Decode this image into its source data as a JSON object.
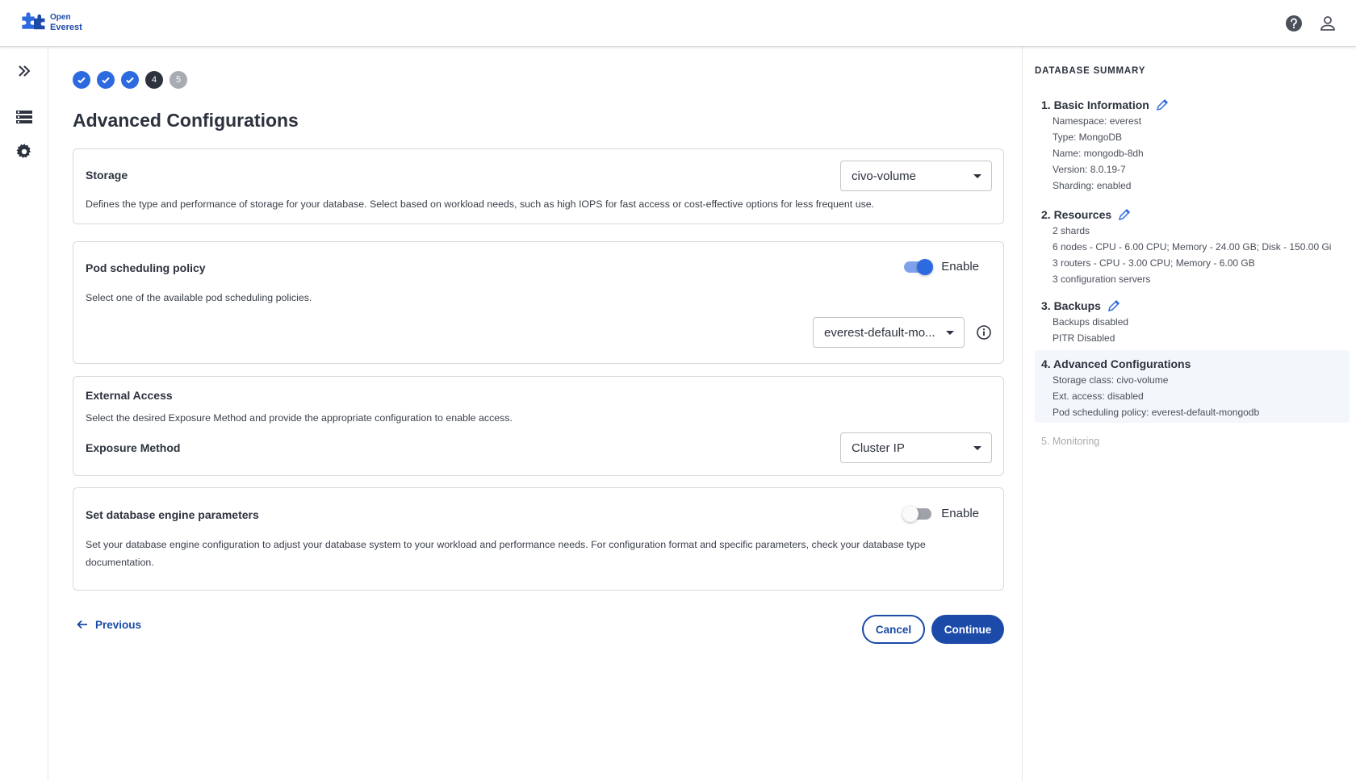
{
  "app": {
    "logo_line1": "Open",
    "logo_line2": "Everest"
  },
  "colors": {
    "primary": "#1b4aa8",
    "step_done": "#2d6ae0",
    "step_active": "#2c323e",
    "step_pending": "#a8abb1"
  },
  "stepper": {
    "steps": [
      {
        "state": "done",
        "icon": "check-icon"
      },
      {
        "state": "done",
        "icon": "check-icon"
      },
      {
        "state": "done",
        "icon": "check-icon"
      },
      {
        "state": "active",
        "label": "4"
      },
      {
        "state": "pending",
        "label": "5"
      }
    ]
  },
  "page": {
    "title": "Advanced Configurations"
  },
  "storage": {
    "title": "Storage",
    "select_value": "civo-volume",
    "description": "Defines the type and performance of storage for your database. Select based on workload needs, such as high IOPS for fast access or cost-effective options for less frequent use."
  },
  "pod_scheduling": {
    "title": "Pod scheduling policy",
    "toggle_label": "Enable",
    "enabled": true,
    "description": "Select one of the available pod scheduling policies.",
    "select_value": "everest-default-mo..."
  },
  "external_access": {
    "title": "External Access",
    "description": "Select the desired Exposure Method and provide the appropriate configuration to enable access.",
    "exposure_label": "Exposure Method",
    "select_value": "Cluster IP"
  },
  "engine_params": {
    "title": "Set database engine parameters",
    "toggle_label": "Enable",
    "enabled": false,
    "description_line1": "Set your database engine configuration to adjust your database system to your workload and performance needs. For configuration format and specific parameters, check your database type",
    "description_line2": "documentation."
  },
  "footer": {
    "previous_label": "Previous",
    "cancel_label": "Cancel",
    "continue_label": "Continue"
  },
  "summary": {
    "heading": "DATABASE SUMMARY",
    "sections": [
      {
        "title": "1. Basic Information",
        "lines": [
          "Namespace: everest",
          "Type: MongoDB",
          "Name: mongodb-8dh",
          "Version: 8.0.19-7",
          "Sharding: enabled"
        ]
      },
      {
        "title": "2. Resources",
        "lines": [
          "2 shards",
          "6 nodes - CPU - 6.00 CPU; Memory - 24.00 GB; Disk - 150.00 Gi",
          "3 routers - CPU - 3.00 CPU; Memory - 6.00 GB",
          "3 configuration servers"
        ]
      },
      {
        "title": "3. Backups",
        "lines": [
          "Backups disabled",
          "PITR Disabled"
        ]
      },
      {
        "title": "4. Advanced Configurations",
        "lines": [
          "Storage class: civo-volume",
          "Ext. access: disabled",
          "Pod scheduling policy: everest-default-mongodb"
        ]
      },
      {
        "title": "5. Monitoring",
        "lines": []
      }
    ]
  }
}
